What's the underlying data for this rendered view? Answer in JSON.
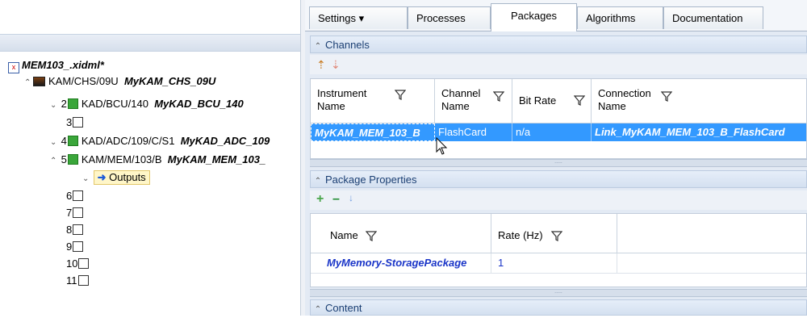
{
  "tabs": [
    "Settings ▾",
    "Processes",
    "Packages",
    "Algorithms",
    "Documentation"
  ],
  "tree": {
    "root": "MEM103_.xidml*",
    "chs": {
      "path": "KAM/CHS/09U",
      "name": "MyKAM_CHS_09U"
    },
    "slots": [
      {
        "num": "2",
        "path": "KAD/BCU/140",
        "name": "MyKAD_BCU_140"
      },
      {
        "num": "3"
      },
      {
        "num": "4",
        "path": "KAD/ADC/109/C/S1",
        "name": "MyKAD_ADC_109"
      },
      {
        "num": "5",
        "path": "KAM/MEM/103/B",
        "name": "MyKAM_MEM_103_"
      },
      {
        "num": "6"
      },
      {
        "num": "7"
      },
      {
        "num": "8"
      },
      {
        "num": "9"
      },
      {
        "num": "10"
      },
      {
        "num": "11"
      }
    ],
    "outputs_label": "Outputs"
  },
  "channels": {
    "title": "Channels",
    "headers": {
      "instrument": "Instrument Name",
      "instrument_l1": "Instrument",
      "instrument_l2": "Name",
      "channel_l1": "Channel",
      "channel_l2": "Name",
      "bitrate": "Bit Rate",
      "connection_l1": "Connection",
      "connection_l2": "Name"
    },
    "row": {
      "instrument": "MyKAM_MEM_103_B",
      "channel": "FlashCard",
      "bitrate": "n/a",
      "connection": "Link_MyKAM_MEM_103_B_FlashCard"
    }
  },
  "package_properties": {
    "title": "Package Properties",
    "headers": {
      "name": "Name",
      "rate": "Rate (Hz)"
    },
    "row": {
      "name": "MyMemory-StoragePackage",
      "rate": "1"
    }
  },
  "content": {
    "title": "Content"
  },
  "colors": {
    "accent": "#3399ff",
    "link": "#1a35c8",
    "header_text": "#1b3f73"
  }
}
